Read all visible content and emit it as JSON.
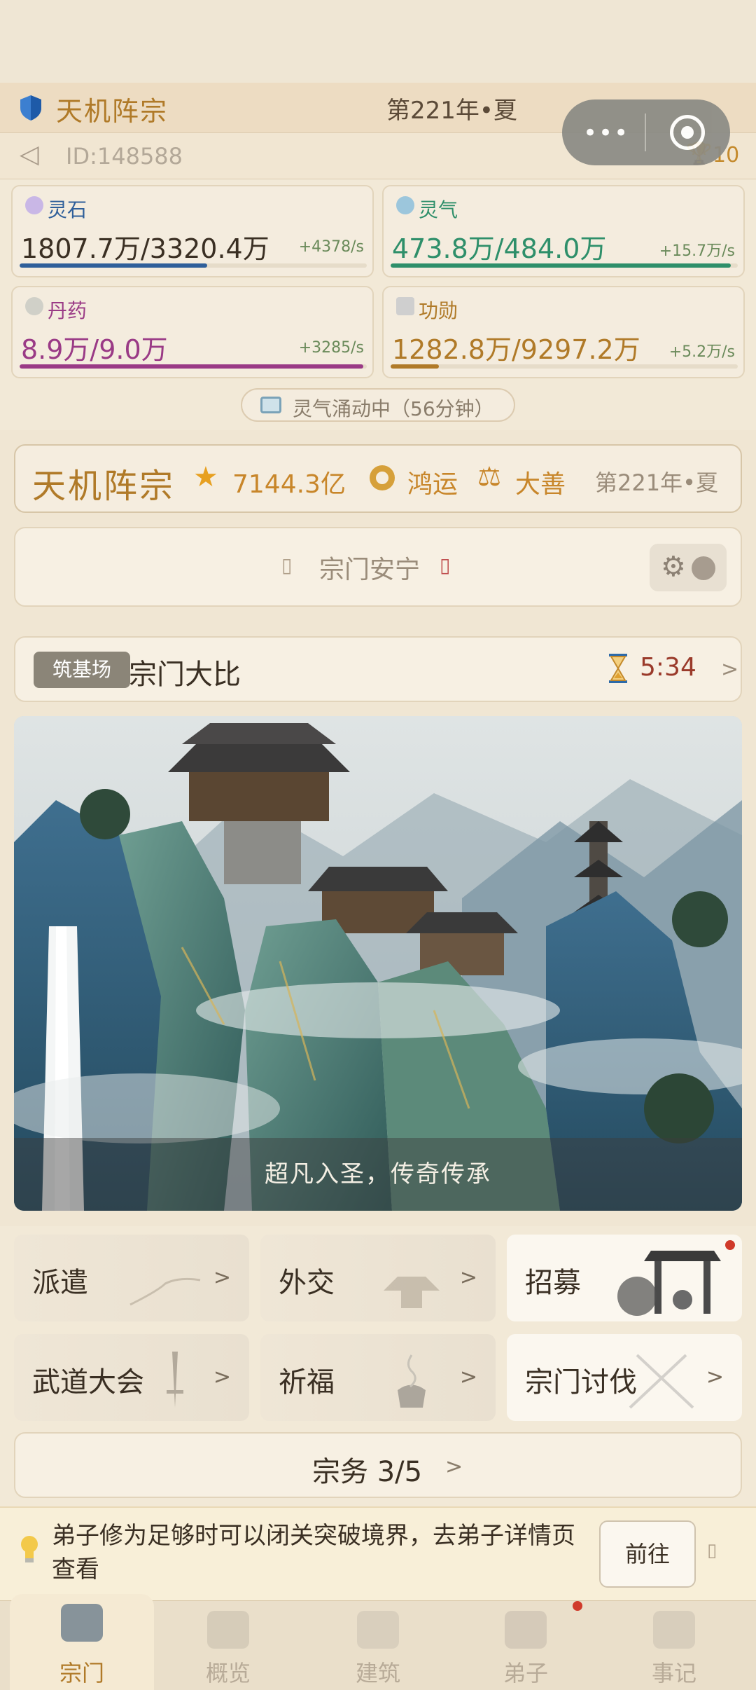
{
  "header": {
    "sect_name": "天机阵宗",
    "year": "第221年•夏",
    "id": "ID:148588",
    "trophy_count": "10"
  },
  "resources": [
    {
      "label": "灵石",
      "value": "1807.7万/3320.4万",
      "rate": "+4378/s",
      "fill": 0.54,
      "color": "#2f5f9a",
      "icon": "spirit-stone-icon"
    },
    {
      "label": "灵气",
      "value": "473.8万/484.0万",
      "rate": "+15.7万/s",
      "fill": 0.98,
      "color": "#2e8f6a",
      "icon": "qi-swirl-icon"
    },
    {
      "label": "丹药",
      "value": "8.9万/9.0万",
      "rate": "+3285/s",
      "fill": 0.99,
      "color": "#9a3a86",
      "icon": "pill-icon"
    },
    {
      "label": "功勋",
      "value": "1282.8万/9297.2万",
      "rate": "+5.2万/s",
      "fill": 0.14,
      "color": "#b07a28",
      "icon": "merit-scroll-icon"
    }
  ],
  "notice": "灵气涌动中（56分钟）",
  "sect_card": {
    "name": "天机阵宗",
    "prestige": "7144.3亿",
    "luck": "鸿运",
    "virtue": "大善",
    "year": "第221年•夏"
  },
  "status": {
    "left_mark": "▯",
    "text": "宗门安宁",
    "right_mark": "▯",
    "gear": "⚙"
  },
  "event": {
    "tag": "筑基场",
    "name": "宗门大比",
    "timer": "5:34",
    "arrow": ">"
  },
  "hero": {
    "caption": "超凡入圣，传奇传承"
  },
  "actions": [
    {
      "label": "派遣",
      "arrow": ">"
    },
    {
      "label": "外交",
      "arrow": ">"
    },
    {
      "label": "招募",
      "arrow": ""
    },
    {
      "label": "武道大会",
      "arrow": ">"
    },
    {
      "label": "祈福",
      "arrow": ">"
    },
    {
      "label": "宗门讨伐",
      "arrow": ">"
    }
  ],
  "affairs": {
    "label": "宗务 3/5",
    "arrow": ">"
  },
  "tip": {
    "text": "弟子修为足够时可以闭关突破境界，去弟子详情页查看",
    "button": "前往",
    "close": "▯"
  },
  "nav": [
    {
      "label": "宗门"
    },
    {
      "label": "概览"
    },
    {
      "label": "建筑"
    },
    {
      "label": "弟子"
    },
    {
      "label": "事记"
    }
  ],
  "colors": {
    "gold": "#b07a28",
    "timer_red": "#9a3a2a",
    "badge_red": "#d03a2a"
  }
}
